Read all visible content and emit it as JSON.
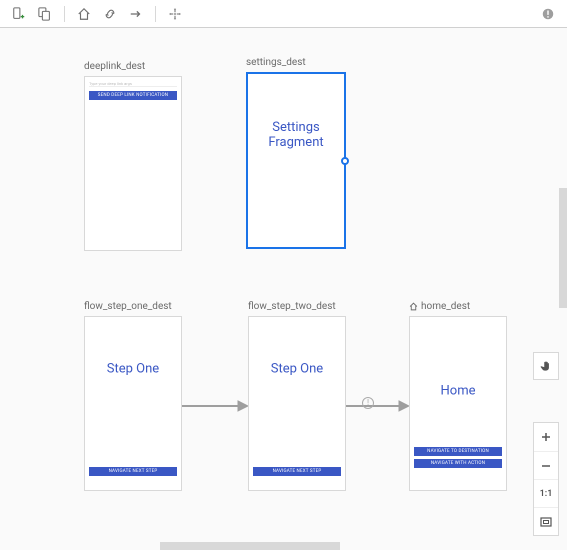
{
  "toolbar": {
    "add_dest": "",
    "nest_graph": "",
    "home": "",
    "deeplink": "",
    "action": "",
    "auto_arrange": "",
    "warning": ""
  },
  "destinations": {
    "deeplink": {
      "label": "deeplink_dest",
      "input_hint": "Type your deep link args",
      "btn": "SEND DEEP LINK NOTIFICATION"
    },
    "settings": {
      "label": "settings_dest",
      "title": "Settings\nFragment"
    },
    "step_one": {
      "label": "flow_step_one_dest",
      "title": "Step One",
      "btn": "NAVIGATE NEXT STEP"
    },
    "step_two": {
      "label": "flow_step_two_dest",
      "title": "Step One",
      "btn": "NAVIGATE NEXT STEP"
    },
    "home": {
      "label": "home_dest",
      "title": "Home",
      "btn1": "NAVIGATE TO DESTINATION",
      "btn2": "NAVIGATE WITH ACTION"
    }
  },
  "controls": {
    "one_to_one": "1:1"
  }
}
